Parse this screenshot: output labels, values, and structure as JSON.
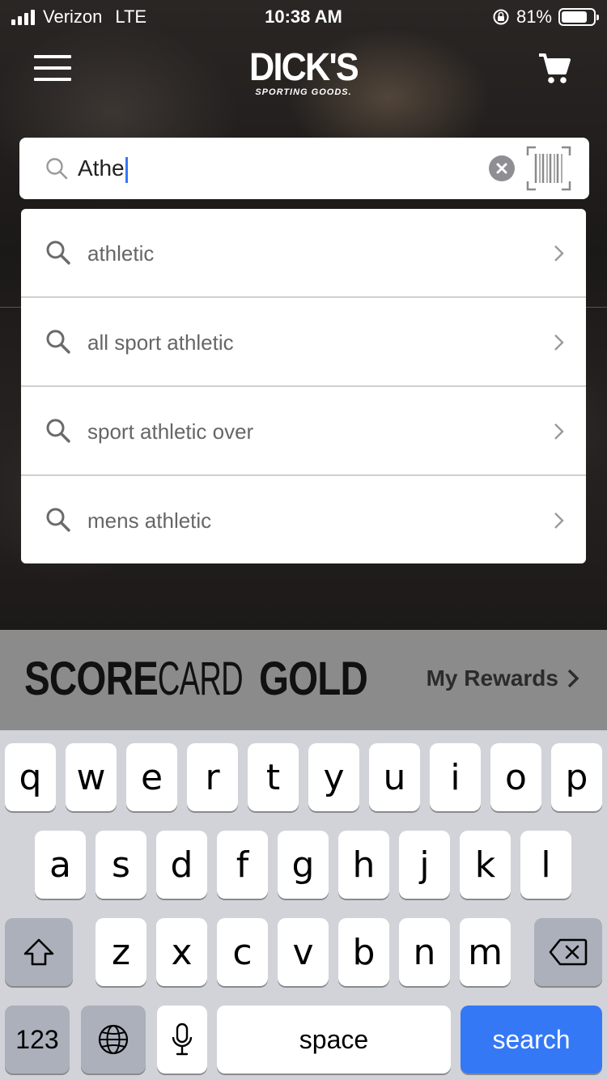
{
  "status_bar": {
    "carrier": "Verizon",
    "network": "LTE",
    "time": "10:38 AM",
    "battery": "81%",
    "battery_level": 0.81
  },
  "header": {
    "logo_main": "DICK'S",
    "logo_sub": "SPORTING GOODS.",
    "menu_icon": "hamburger-icon",
    "cart_icon": "cart-icon"
  },
  "search": {
    "value": "Athe",
    "search_icon": "search-icon",
    "clear_icon": "clear-icon",
    "barcode_icon": "barcode-icon"
  },
  "suggestions": [
    {
      "label": "athletic"
    },
    {
      "label": "all sport athletic"
    },
    {
      "label": "sport athletic over"
    },
    {
      "label": "mens athletic"
    }
  ],
  "rewards": {
    "brand_bold_1": "SCORE",
    "brand_light": "CARD",
    "brand_bold_2": "GOLD",
    "link_label": "My Rewards"
  },
  "keyboard": {
    "row1": [
      "q",
      "w",
      "e",
      "r",
      "t",
      "y",
      "u",
      "i",
      "o",
      "p"
    ],
    "row2": [
      "a",
      "s",
      "d",
      "f",
      "g",
      "h",
      "j",
      "k",
      "l"
    ],
    "row3": [
      "z",
      "x",
      "c",
      "v",
      "b",
      "n",
      "m"
    ],
    "numbers_label": "123",
    "space_label": "space",
    "search_label": "search",
    "accent": "#3478f6"
  }
}
